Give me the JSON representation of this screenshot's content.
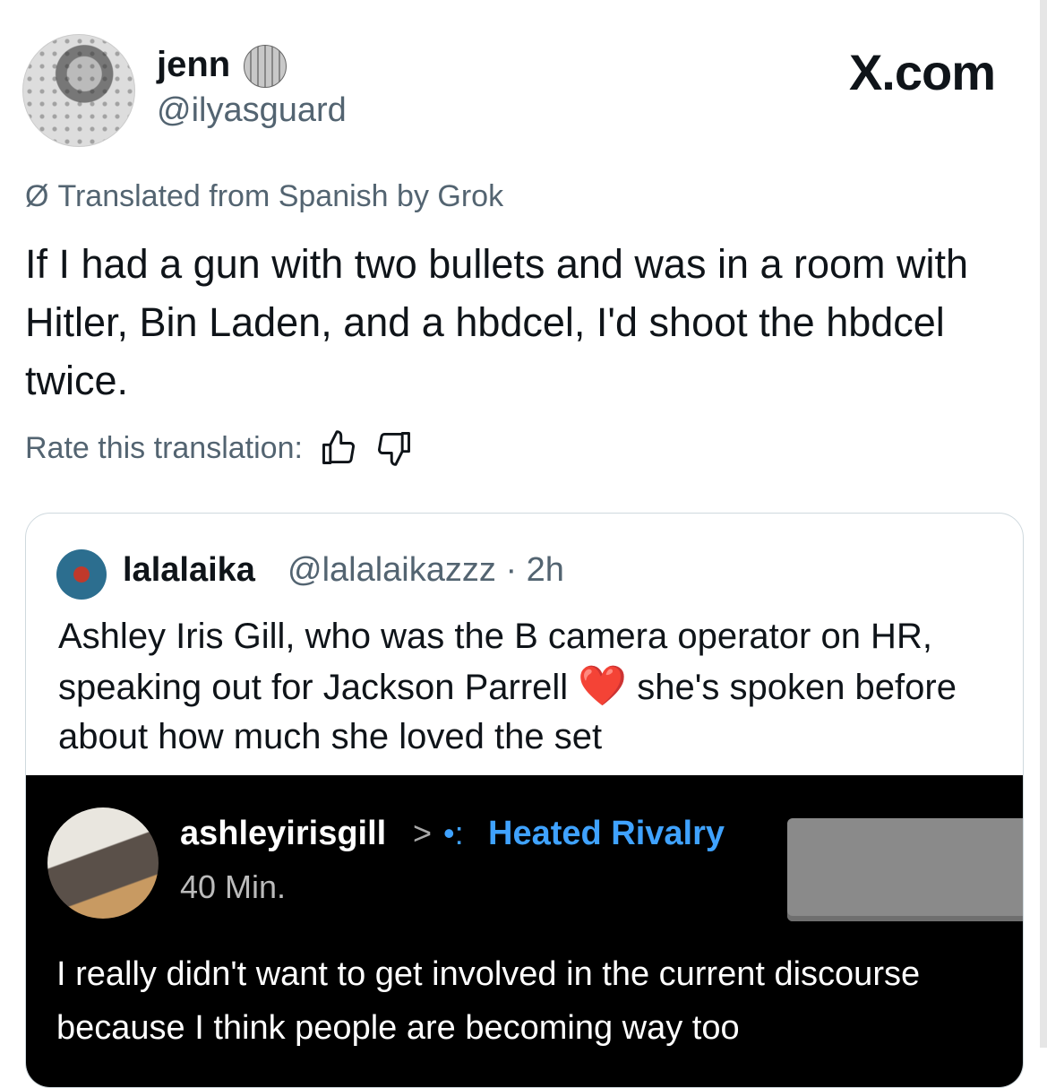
{
  "post": {
    "author_name": "jenn",
    "author_handle": "@ilyasguard",
    "brand": "X.com",
    "translation_notice": "Translated from Spanish by Grok",
    "text": "If I had a gun with two bullets and was in a room with Hitler, Bin Laden, and a hbdcel, I'd shoot the hbdcel twice.",
    "rate_label": "Rate this translation:",
    "icons": [
      "globe-badge-icon",
      "grok-icon",
      "thumbs-up-icon",
      "thumbs-down-icon"
    ]
  },
  "quote": {
    "name": "lalalaika",
    "handle_time": "@lalalaikazzz · 2h",
    "text_before_heart": "Ashley Iris Gill, who was the B camera operator on HR, speaking out for Jackson Parrell ",
    "heart": "❤️",
    "text_after_heart": " she's spoken before about how much she loved the set",
    "embedded": {
      "username": "ashleyirisgill",
      "arrow": ">",
      "community_dots": "•:",
      "community": "Heated Rivalry",
      "time": "40 Min.",
      "text": "I really didn't want to get involved in the current discourse because I think people are becoming way too"
    }
  }
}
